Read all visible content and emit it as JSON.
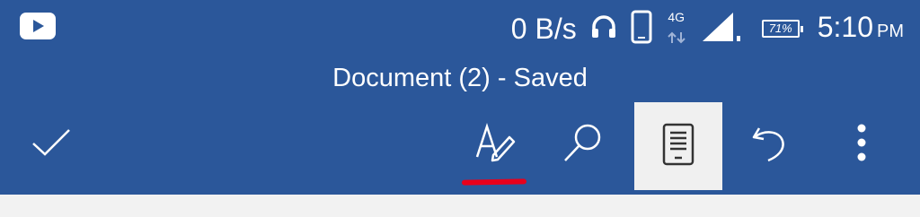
{
  "status_bar": {
    "app_icon": "youtube-icon",
    "net_speed": "0 B/s",
    "headphones_icon": "headphones-icon",
    "phone_icon": "phone-icon",
    "network_type": "4G",
    "signal_icon": "signal-icon",
    "battery_percent": "71%",
    "time": "5:10",
    "ampm": "PM"
  },
  "document": {
    "title": "Document (2) - Saved"
  },
  "toolbar": {
    "items": [
      {
        "name": "done",
        "icon": "checkmark-icon"
      },
      {
        "name": "draw",
        "icon": "draw-pen-icon"
      },
      {
        "name": "find",
        "icon": "search-icon"
      },
      {
        "name": "mobile_view",
        "icon": "mobile-view-icon",
        "active": true
      },
      {
        "name": "undo",
        "icon": "undo-icon"
      },
      {
        "name": "more",
        "icon": "more-vertical-icon"
      }
    ]
  },
  "colors": {
    "appbar": "#2b579a",
    "active_button_bg": "#f0f0f0",
    "annotation_red": "#e8001c"
  }
}
